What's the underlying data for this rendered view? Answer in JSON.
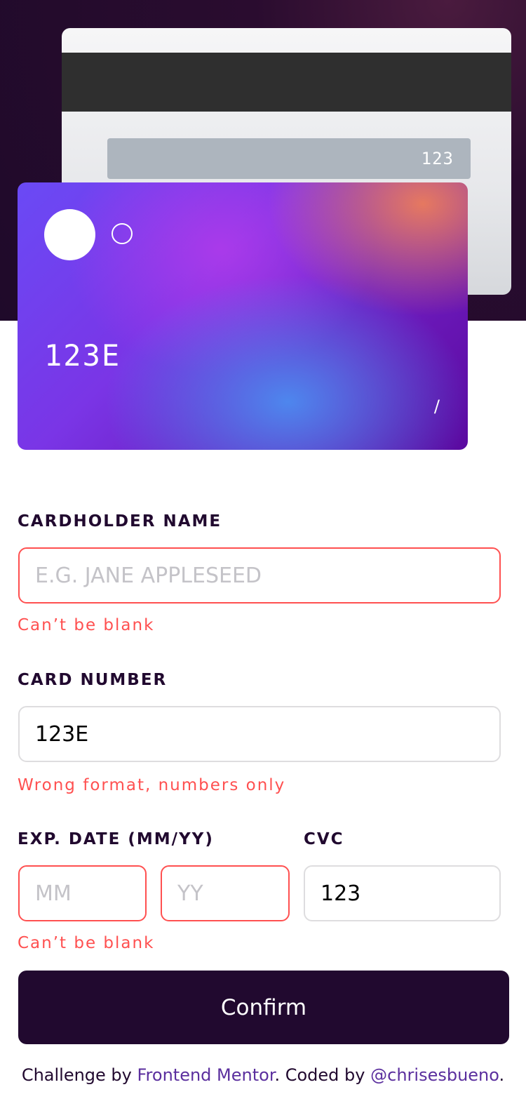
{
  "card_back": {
    "cvc": "123"
  },
  "card_front": {
    "number": "123E",
    "date": "/"
  },
  "form": {
    "cardholder": {
      "label": "CARDHOLDER NAME",
      "placeholder": "E.G. JANE APPLESEED",
      "value": "",
      "error": "Can’t be blank"
    },
    "card_number": {
      "label": "CARD NUMBER",
      "placeholder": "",
      "value": "123E",
      "error": "Wrong format, numbers only"
    },
    "exp_date": {
      "label": "EXP. DATE (MM/YY)",
      "mm_placeholder": "MM",
      "yy_placeholder": "YY",
      "error": "Can’t be blank"
    },
    "cvc": {
      "label": "CVC",
      "value": "123"
    },
    "confirm_label": "Confirm"
  },
  "footer": {
    "prefix": "Challenge by ",
    "link1": "Frontend Mentor",
    "middle": ". Coded by ",
    "link2": "@chrisesbueno",
    "suffix": "."
  },
  "colors": {
    "dark": "#21092f",
    "error": "#ff5050",
    "link": "#5b2f9e"
  }
}
